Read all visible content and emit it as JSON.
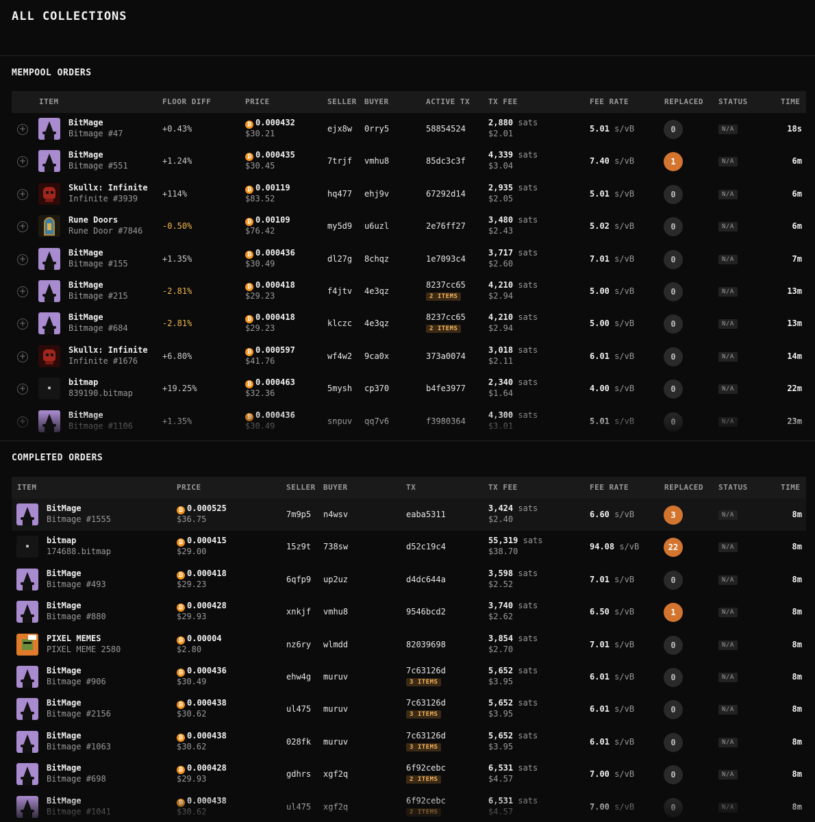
{
  "page_title": "ALL COLLECTIONS",
  "mempool": {
    "title": "MEMPOOL ORDERS",
    "headers": {
      "item": "ITEM",
      "floor_diff": "FLOOR DIFF",
      "price": "PRICE",
      "seller": "SELLER",
      "buyer": "BUYER",
      "active_tx": "ACTIVE TX",
      "tx_fee": "TX FEE",
      "fee_rate": "FEE RATE",
      "replaced": "REPLACED",
      "status": "STATUS",
      "time": "TIME"
    },
    "rows": [
      {
        "thumb": "bitmage",
        "name": "BitMage",
        "sub": "Bitmage #47",
        "diff": "+0.43%",
        "diff_neg": false,
        "price": "0.000432",
        "usd": "$30.21",
        "seller": "ejx8w",
        "buyer": "0rry5",
        "tx": "58854524",
        "items": "",
        "sats": "2,880",
        "fee_usd": "$2.01",
        "fee_rate": "5.01",
        "replaced": "0",
        "status": "N/A",
        "time": "18s"
      },
      {
        "thumb": "bitmage",
        "name": "BitMage",
        "sub": "Bitmage #551",
        "diff": "+1.24%",
        "diff_neg": false,
        "price": "0.000435",
        "usd": "$30.45",
        "seller": "7trjf",
        "buyer": "vmhu8",
        "tx": "85dc3c3f",
        "items": "",
        "sats": "4,339",
        "fee_usd": "$3.04",
        "fee_rate": "7.40",
        "replaced": "1",
        "status": "N/A",
        "time": "6m"
      },
      {
        "thumb": "skull",
        "name": "Skullx: Infinite",
        "sub": "Infinite #3939",
        "diff": "+114%",
        "diff_neg": false,
        "price": "0.00119",
        "usd": "$83.52",
        "seller": "hq477",
        "buyer": "ehj9v",
        "tx": "67292d14",
        "items": "",
        "sats": "2,935",
        "fee_usd": "$2.05",
        "fee_rate": "5.01",
        "replaced": "0",
        "status": "N/A",
        "time": "6m"
      },
      {
        "thumb": "rune",
        "name": "Rune Doors",
        "sub": "Rune Door #7846",
        "diff": "-0.50%",
        "diff_neg": true,
        "price": "0.00109",
        "usd": "$76.42",
        "seller": "my5d9",
        "buyer": "u6uzl",
        "tx": "2e76ff27",
        "items": "",
        "sats": "3,480",
        "fee_usd": "$2.43",
        "fee_rate": "5.02",
        "replaced": "0",
        "status": "N/A",
        "time": "6m"
      },
      {
        "thumb": "bitmage",
        "name": "BitMage",
        "sub": "Bitmage #155",
        "diff": "+1.35%",
        "diff_neg": false,
        "price": "0.000436",
        "usd": "$30.49",
        "seller": "dl27g",
        "buyer": "8chqz",
        "tx": "1e7093c4",
        "items": "",
        "sats": "3,717",
        "fee_usd": "$2.60",
        "fee_rate": "7.01",
        "replaced": "0",
        "status": "N/A",
        "time": "7m"
      },
      {
        "thumb": "bitmage",
        "name": "BitMage",
        "sub": "Bitmage #215",
        "diff": "-2.81%",
        "diff_neg": true,
        "price": "0.000418",
        "usd": "$29.23",
        "seller": "f4jtv",
        "buyer": "4e3qz",
        "tx": "8237cc65",
        "items": "2 ITEMS",
        "sats": "4,210",
        "fee_usd": "$2.94",
        "fee_rate": "5.00",
        "replaced": "0",
        "status": "N/A",
        "time": "13m"
      },
      {
        "thumb": "bitmage",
        "name": "BitMage",
        "sub": "Bitmage #684",
        "diff": "-2.81%",
        "diff_neg": true,
        "price": "0.000418",
        "usd": "$29.23",
        "seller": "klczc",
        "buyer": "4e3qz",
        "tx": "8237cc65",
        "items": "2 ITEMS",
        "sats": "4,210",
        "fee_usd": "$2.94",
        "fee_rate": "5.00",
        "replaced": "0",
        "status": "N/A",
        "time": "13m"
      },
      {
        "thumb": "skull",
        "name": "Skullx: Infinite",
        "sub": "Infinite #1676",
        "diff": "+6.80%",
        "diff_neg": false,
        "price": "0.000597",
        "usd": "$41.76",
        "seller": "wf4w2",
        "buyer": "9ca0x",
        "tx": "373a0074",
        "items": "",
        "sats": "3,018",
        "fee_usd": "$2.11",
        "fee_rate": "6.01",
        "replaced": "0",
        "status": "N/A",
        "time": "14m"
      },
      {
        "thumb": "bitmap",
        "name": "bitmap",
        "sub": "839190.bitmap",
        "diff": "+19.25%",
        "diff_neg": false,
        "price": "0.000463",
        "usd": "$32.36",
        "seller": "5mysh",
        "buyer": "cp370",
        "tx": "b4fe3977",
        "items": "",
        "sats": "2,340",
        "fee_usd": "$1.64",
        "fee_rate": "4.00",
        "replaced": "0",
        "status": "N/A",
        "time": "22m"
      },
      {
        "thumb": "bitmage",
        "name": "BitMage",
        "sub": "Bitmage #1106",
        "diff": "+1.35%",
        "diff_neg": false,
        "price": "0.000436",
        "usd": "$30.49",
        "seller": "snpuv",
        "buyer": "qq7v6",
        "tx": "f3980364",
        "items": "",
        "sats": "4,300",
        "fee_usd": "$3.01",
        "fee_rate": "5.01",
        "replaced": "0",
        "status": "N/A",
        "time": "23m"
      }
    ]
  },
  "completed": {
    "title": "COMPLETED ORDERS",
    "headers": {
      "item": "ITEM",
      "price": "PRICE",
      "seller": "SELLER",
      "buyer": "BUYER",
      "tx": "TX",
      "tx_fee": "TX FEE",
      "fee_rate": "FEE RATE",
      "replaced": "REPLACED",
      "status": "STATUS",
      "time": "TIME"
    },
    "rows": [
      {
        "thumb": "bitmage",
        "name": "BitMage",
        "sub": "Bitmage #1555",
        "price": "0.000525",
        "usd": "$36.75",
        "seller": "7m9p5",
        "buyer": "n4wsv",
        "tx": "eaba5311",
        "items": "",
        "sats": "3,424",
        "fee_usd": "$2.40",
        "fee_rate": "6.60",
        "replaced": "3",
        "status": "N/A",
        "time": "8m"
      },
      {
        "thumb": "bitmap",
        "name": "bitmap",
        "sub": "174688.bitmap",
        "price": "0.000415",
        "usd": "$29.00",
        "seller": "15z9t",
        "buyer": "738sw",
        "tx": "d52c19c4",
        "items": "",
        "sats": "55,319",
        "fee_usd": "$38.70",
        "fee_rate": "94.08",
        "replaced": "22",
        "status": "N/A",
        "time": "8m"
      },
      {
        "thumb": "bitmage",
        "name": "BitMage",
        "sub": "Bitmage #493",
        "price": "0.000418",
        "usd": "$29.23",
        "seller": "6qfp9",
        "buyer": "up2uz",
        "tx": "d4dc644a",
        "items": "",
        "sats": "3,598",
        "fee_usd": "$2.52",
        "fee_rate": "7.01",
        "replaced": "0",
        "status": "N/A",
        "time": "8m"
      },
      {
        "thumb": "bitmage",
        "name": "BitMage",
        "sub": "Bitmage #880",
        "price": "0.000428",
        "usd": "$29.93",
        "seller": "xnkjf",
        "buyer": "vmhu8",
        "tx": "9546bcd2",
        "items": "",
        "sats": "3,740",
        "fee_usd": "$2.62",
        "fee_rate": "6.50",
        "replaced": "1",
        "status": "N/A",
        "time": "8m"
      },
      {
        "thumb": "pixel",
        "name": "PIXEL MEMES",
        "sub": "PIXEL MEME 2580",
        "price": "0.00004",
        "usd": "$2.80",
        "seller": "nz6ry",
        "buyer": "wlmdd",
        "tx": "82039698",
        "items": "",
        "sats": "3,854",
        "fee_usd": "$2.70",
        "fee_rate": "7.01",
        "replaced": "0",
        "status": "N/A",
        "time": "8m"
      },
      {
        "thumb": "bitmage",
        "name": "BitMage",
        "sub": "Bitmage #906",
        "price": "0.000436",
        "usd": "$30.49",
        "seller": "ehw4g",
        "buyer": "muruv",
        "tx": "7c63126d",
        "items": "3 ITEMS",
        "sats": "5,652",
        "fee_usd": "$3.95",
        "fee_rate": "6.01",
        "replaced": "0",
        "status": "N/A",
        "time": "8m"
      },
      {
        "thumb": "bitmage",
        "name": "BitMage",
        "sub": "Bitmage #2156",
        "price": "0.000438",
        "usd": "$30.62",
        "seller": "ul475",
        "buyer": "muruv",
        "tx": "7c63126d",
        "items": "3 ITEMS",
        "sats": "5,652",
        "fee_usd": "$3.95",
        "fee_rate": "6.01",
        "replaced": "0",
        "status": "N/A",
        "time": "8m"
      },
      {
        "thumb": "bitmage",
        "name": "BitMage",
        "sub": "Bitmage #1063",
        "price": "0.000438",
        "usd": "$30.62",
        "seller": "028fk",
        "buyer": "muruv",
        "tx": "7c63126d",
        "items": "3 ITEMS",
        "sats": "5,652",
        "fee_usd": "$3.95",
        "fee_rate": "6.01",
        "replaced": "0",
        "status": "N/A",
        "time": "8m"
      },
      {
        "thumb": "bitmage",
        "name": "BitMage",
        "sub": "Bitmage #698",
        "price": "0.000428",
        "usd": "$29.93",
        "seller": "gdhrs",
        "buyer": "xgf2q",
        "tx": "6f92cebc",
        "items": "2 ITEMS",
        "sats": "6,531",
        "fee_usd": "$4.57",
        "fee_rate": "7.00",
        "replaced": "0",
        "status": "N/A",
        "time": "8m"
      },
      {
        "thumb": "bitmage",
        "name": "BitMage",
        "sub": "Bitmage #1041",
        "price": "0.000438",
        "usd": "$30.62",
        "seller": "ul475",
        "buyer": "xgf2q",
        "tx": "6f92cebc",
        "items": "2 ITEMS",
        "sats": "6,531",
        "fee_usd": "$4.57",
        "fee_rate": "7.00",
        "replaced": "0",
        "status": "N/A",
        "time": "8m"
      }
    ]
  },
  "units": {
    "sats": "sats",
    "fee_rate": "s/vB"
  },
  "icons": {
    "coin": "bitcoin-icon",
    "add": "plus-circle-icon"
  },
  "colors": {
    "accent_orange": "#d4752f",
    "negative_diff": "#f2b84b",
    "bitcoin": "#f7931a",
    "background": "#0b0b0b"
  }
}
